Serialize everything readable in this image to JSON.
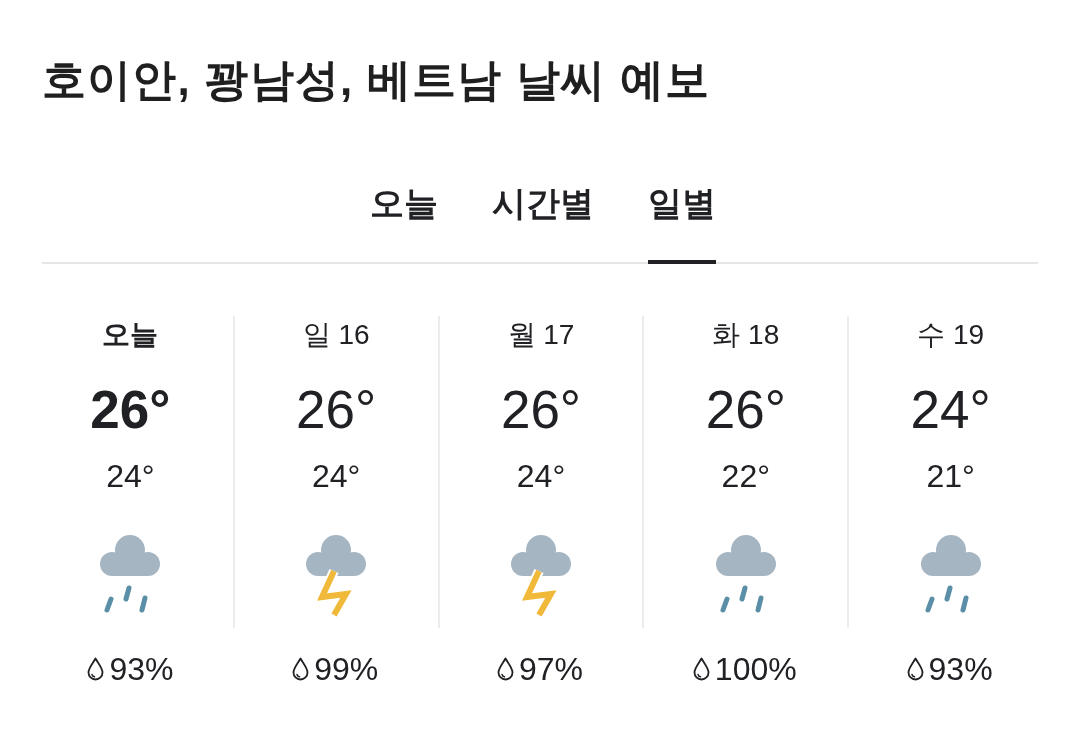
{
  "title": "호이안, 꽝남성, 베트남 날씨 예보",
  "tabs": [
    {
      "label": "오늘",
      "selected": false
    },
    {
      "label": "시간별",
      "selected": false
    },
    {
      "label": "일별",
      "selected": true
    }
  ],
  "days": [
    {
      "label": "오늘",
      "selected": true,
      "high": "26°",
      "low": "24°",
      "kind": "rain",
      "precip": "93%"
    },
    {
      "label": "일 16",
      "selected": false,
      "high": "26°",
      "low": "24°",
      "kind": "thunderstorm",
      "precip": "99%"
    },
    {
      "label": "월 17",
      "selected": false,
      "high": "26°",
      "low": "24°",
      "kind": "thunderstorm",
      "precip": "97%"
    },
    {
      "label": "화 18",
      "selected": false,
      "high": "26°",
      "low": "22°",
      "kind": "rain",
      "precip": "100%"
    },
    {
      "label": "수 19",
      "selected": false,
      "high": "24°",
      "low": "21°",
      "kind": "rain",
      "precip": "93%"
    }
  ]
}
